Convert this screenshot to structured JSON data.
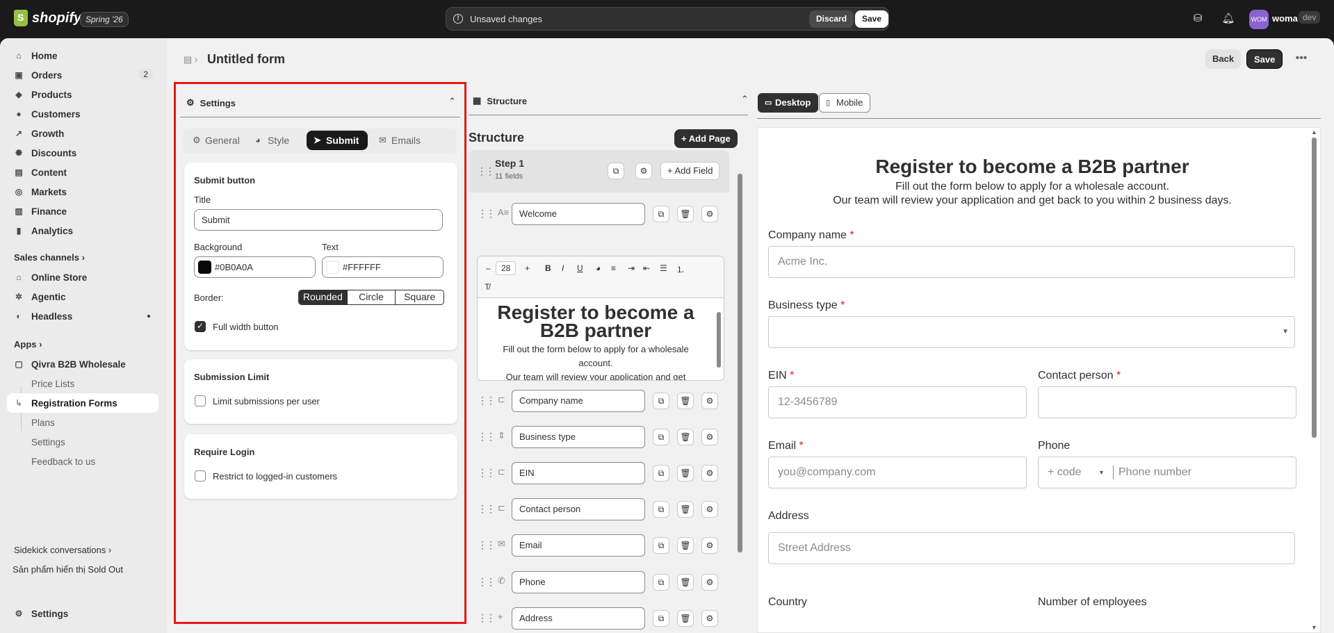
{
  "topbar": {
    "brand": "shopify",
    "edition": "Spring '26",
    "unsaved_label": "Unsaved changes",
    "discard_label": "Discard",
    "save_label": "Save",
    "avatar_initials": "WOM",
    "user_name": "woma",
    "env": "dev"
  },
  "sidebar": {
    "items": [
      {
        "label": "Home",
        "icon": "home-icon"
      },
      {
        "label": "Orders",
        "icon": "orders-icon",
        "badge": "2"
      },
      {
        "label": "Products",
        "icon": "tag-icon"
      },
      {
        "label": "Customers",
        "icon": "person-icon"
      },
      {
        "label": "Growth",
        "icon": "growth-icon"
      },
      {
        "label": "Discounts",
        "icon": "discount-icon"
      },
      {
        "label": "Content",
        "icon": "content-icon"
      },
      {
        "label": "Markets",
        "icon": "globe-icon"
      },
      {
        "label": "Finance",
        "icon": "bank-icon"
      },
      {
        "label": "Analytics",
        "icon": "chart-icon"
      }
    ],
    "sales_channels_label": "Sales channels",
    "channels": [
      {
        "label": "Online Store",
        "icon": "store-icon"
      },
      {
        "label": "Agentic",
        "icon": "agentic-icon"
      },
      {
        "label": "Headless",
        "icon": "headless-icon"
      }
    ],
    "apps_label": "Apps",
    "app_name": "Qivra B2B Wholesale",
    "app_items": [
      "Price Lists",
      "Registration Forms",
      "Plans",
      "Settings",
      "Feedback to us"
    ],
    "sidekick_label": "Sidekick conversations",
    "sidekick_item": "Sản phẩm hiển thị Sold Out",
    "settings_label": "Settings"
  },
  "page": {
    "title": "Untitled form",
    "back_label": "Back",
    "save_label": "Save"
  },
  "settings_panel": {
    "title": "Settings",
    "tabs": [
      "General",
      "Style",
      "Submit",
      "Emails"
    ],
    "active_tab": "Submit",
    "submit_button": {
      "heading": "Submit button",
      "title_label": "Title",
      "title_value": "Submit",
      "background_label": "Background",
      "background_value": "#0B0A0A",
      "text_label": "Text",
      "text_value": "#FFFFFF",
      "border_label": "Border:",
      "border_options": [
        "Rounded",
        "Circle",
        "Square"
      ],
      "border_selected": "Rounded",
      "full_width_label": "Full width button",
      "full_width_checked": true
    },
    "submission_limit": {
      "heading": "Submission Limit",
      "checkbox_label": "Limit submissions per user",
      "checked": false
    },
    "require_login": {
      "heading": "Require Login",
      "checkbox_label": "Restrict to logged-in customers",
      "checked": false
    }
  },
  "structure_panel": {
    "header": "Structure",
    "title": "Structure",
    "add_page_label": "Add Page",
    "step_title": "Step 1",
    "step_fields": "11 fields",
    "add_field_label": "Add Field",
    "fields": [
      {
        "label": "Welcome",
        "icon": "text-icon"
      },
      {
        "label": "Company name",
        "icon": "input-icon"
      },
      {
        "label": "Business type",
        "icon": "select-icon"
      },
      {
        "label": "EIN",
        "icon": "input-icon"
      },
      {
        "label": "Contact person",
        "icon": "input-icon"
      },
      {
        "label": "Email",
        "icon": "mail-icon"
      },
      {
        "label": "Phone",
        "icon": "phone-icon"
      },
      {
        "label": "Address",
        "icon": "pin-icon"
      }
    ],
    "editor": {
      "font_size": "28",
      "heading": "Register to become a B2B partner",
      "line1": "Fill out the form below to apply for a wholesale account.",
      "line2": "Our team will review your application and get"
    }
  },
  "preview": {
    "desktop_label": "Desktop",
    "mobile_label": "Mobile",
    "title": "Register to become a B2B partner",
    "line1": "Fill out the form below to apply for a wholesale account.",
    "line2": "Our team will review your application and get back to you within 2 business days.",
    "company_label": "Company name",
    "company_placeholder": "Acme Inc.",
    "business_label": "Business type",
    "ein_label": "EIN",
    "ein_placeholder": "12-3456789",
    "contact_label": "Contact person",
    "email_label": "Email",
    "email_placeholder": "you@company.com",
    "phone_label": "Phone",
    "phone_code": "+ code",
    "phone_placeholder": "Phone number",
    "address_label": "Address",
    "address_placeholder": "Street Address",
    "country_label": "Country",
    "employees_label": "Number of employees",
    "required_mark": "*"
  },
  "colors": {
    "highlight": "#e01b1b",
    "required": "#e51c00",
    "dark": "#303030"
  }
}
